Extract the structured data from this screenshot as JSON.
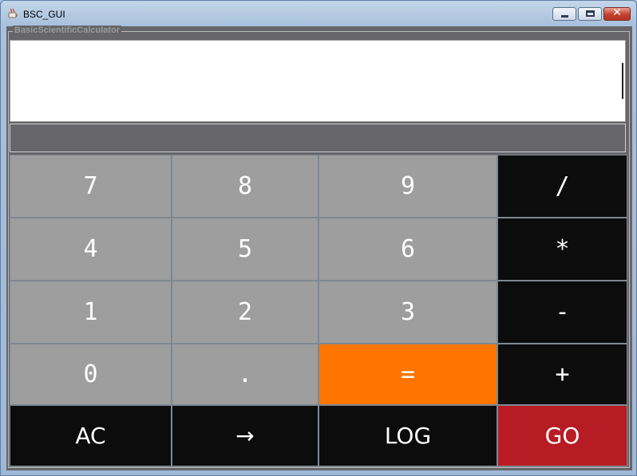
{
  "window": {
    "title": "BSC_GUI",
    "close_glyph": "✕"
  },
  "group": {
    "title": "BasicScientificCalculator"
  },
  "display": {
    "value": "",
    "sub_value": ""
  },
  "colors": {
    "digit_key": "#9e9e9e",
    "operator_key": "#0c0c0c",
    "equals_key": "#ff7500",
    "go_key": "#b71c24",
    "background": "#666569"
  },
  "keys": {
    "seven": "7",
    "eight": "8",
    "nine": "9",
    "divide": "/",
    "four": "4",
    "five": "5",
    "six": "6",
    "multiply": "*",
    "one": "1",
    "two": "2",
    "three": "3",
    "subtract": "-",
    "zero": "0",
    "decimal": ".",
    "equals": "=",
    "add": "+",
    "clear": "AC",
    "backspace": "→",
    "log": "LOG",
    "go": "GO"
  }
}
